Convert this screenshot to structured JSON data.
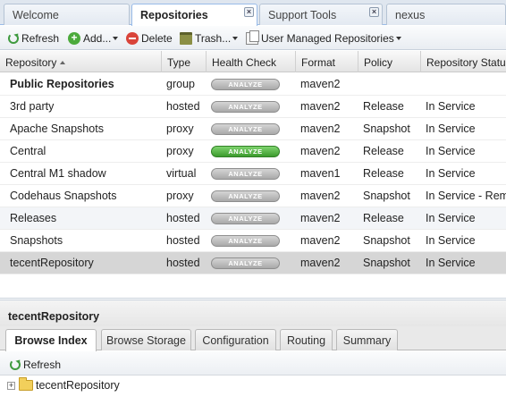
{
  "top_tabs": [
    {
      "label": "Welcome"
    },
    {
      "label": "Repositories",
      "closable": true
    },
    {
      "label": "Support Tools",
      "closable": true
    },
    {
      "label": "nexus"
    }
  ],
  "close_glyph": "×",
  "toolbar": {
    "refresh": "Refresh",
    "add": "Add...",
    "delete": "Delete",
    "trash": "Trash...",
    "view_select": "User Managed Repositories"
  },
  "grid": {
    "columns": [
      "Repository",
      "Type",
      "Health Check",
      "Format",
      "Policy",
      "Repository Status"
    ],
    "analyze_label": "ANALYZE",
    "rows": [
      {
        "name": "Public Repositories",
        "type": "group",
        "format": "maven2",
        "policy": "",
        "status": "",
        "analyze": "gray",
        "group": true
      },
      {
        "name": "3rd party",
        "type": "hosted",
        "format": "maven2",
        "policy": "Release",
        "status": "In Service",
        "analyze": "gray"
      },
      {
        "name": "Apache Snapshots",
        "type": "proxy",
        "format": "maven2",
        "policy": "Snapshot",
        "status": "In Service",
        "analyze": "gray"
      },
      {
        "name": "Central",
        "type": "proxy",
        "format": "maven2",
        "policy": "Release",
        "status": "In Service",
        "analyze": "green"
      },
      {
        "name": "Central M1 shadow",
        "type": "virtual",
        "format": "maven1",
        "policy": "Release",
        "status": "In Service",
        "analyze": "gray"
      },
      {
        "name": "Codehaus Snapshots",
        "type": "proxy",
        "format": "maven2",
        "policy": "Snapshot",
        "status": "In Service - Rem",
        "analyze": "gray"
      },
      {
        "name": "Releases",
        "type": "hosted",
        "format": "maven2",
        "policy": "Release",
        "status": "In Service",
        "analyze": "gray"
      },
      {
        "name": "Snapshots",
        "type": "hosted",
        "format": "maven2",
        "policy": "Snapshot",
        "status": "In Service",
        "analyze": "gray"
      },
      {
        "name": "tecentRepository",
        "type": "hosted",
        "format": "maven2",
        "policy": "Snapshot",
        "status": "In Service",
        "analyze": "gray",
        "selected": true
      }
    ]
  },
  "detail": {
    "title": "tecentRepository",
    "tabs": [
      "Browse Index",
      "Browse Storage",
      "Configuration",
      "Routing",
      "Summary"
    ],
    "refresh": "Refresh",
    "tree_root": "tecentRepository",
    "expand_glyph": "+"
  },
  "colors": {
    "analyze_green": "#3c9b2d",
    "selected_row": "#d6d6d6",
    "tab_border": "#99bbe8"
  }
}
